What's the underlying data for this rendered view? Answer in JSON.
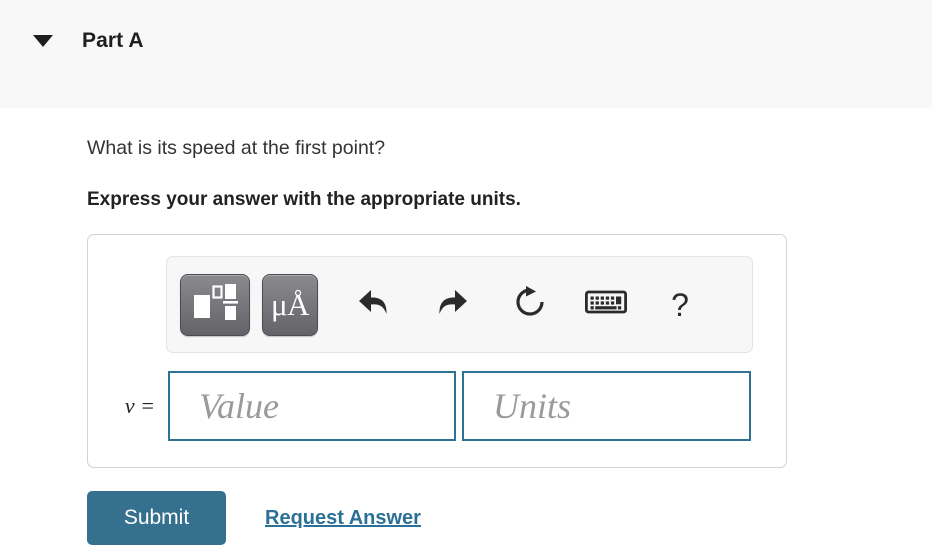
{
  "part_header": {
    "title": "Part A",
    "disclosure_icon": "caret-down-icon",
    "expanded": "true",
    "background_color": "#f8f8f8"
  },
  "question": {
    "prompt": "What is its speed at the first point?",
    "instruction": "Express your answer with the appropriate units."
  },
  "answer_card": {
    "toolbar": {
      "buttons": [
        {
          "name": "math-template-button",
          "icon": "math-template-icon",
          "label": ""
        },
        {
          "name": "units-button",
          "icon": "micro-angstrom-icon",
          "label": "μÅ"
        },
        {
          "name": "undo-button",
          "icon": "undo-arrow-icon",
          "label": ""
        },
        {
          "name": "redo-button",
          "icon": "redo-arrow-icon",
          "label": ""
        },
        {
          "name": "reset-button",
          "icon": "reset-circular-arrow-icon",
          "label": ""
        },
        {
          "name": "keyboard-button",
          "icon": "keyboard-icon",
          "label": ""
        },
        {
          "name": "help-button",
          "icon": "question-mark-icon",
          "label": "?"
        }
      ]
    },
    "input_row": {
      "variable_label": "v =",
      "value_field": {
        "value": "",
        "placeholder": "Value"
      },
      "units_field": {
        "value": "",
        "placeholder": "Units"
      }
    },
    "border_color": "#d2d2d2"
  },
  "actions": {
    "submit_label": "Submit",
    "submit_color": "#35708f",
    "request_answer_label": "Request Answer",
    "link_color": "#2b7096"
  }
}
